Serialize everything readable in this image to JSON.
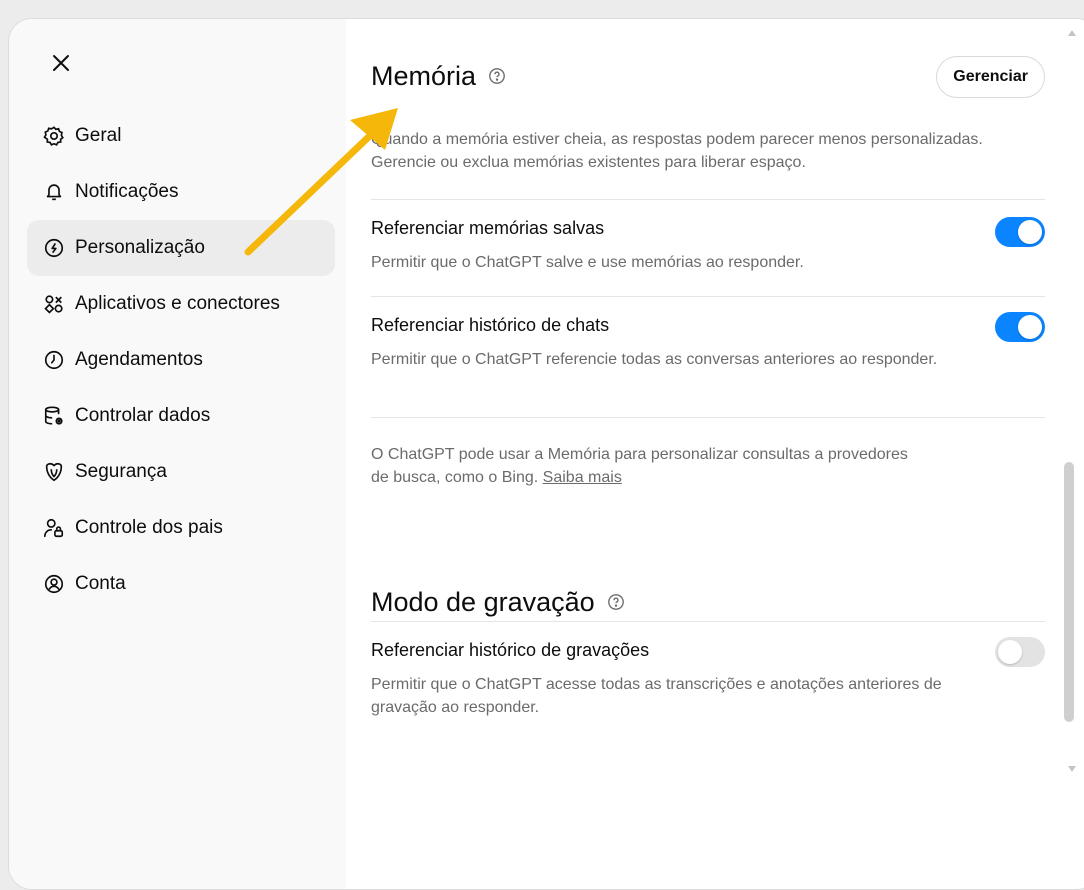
{
  "sidebar": {
    "items": [
      {
        "label": "Geral",
        "icon": "gear-icon"
      },
      {
        "label": "Notificações",
        "icon": "bell-icon"
      },
      {
        "label": "Personalização",
        "icon": "personalization-icon",
        "active": true
      },
      {
        "label": "Aplicativos e conectores",
        "icon": "apps-icon"
      },
      {
        "label": "Agendamentos",
        "icon": "clock-icon"
      },
      {
        "label": "Controlar dados",
        "icon": "database-gear-icon"
      },
      {
        "label": "Segurança",
        "icon": "security-icon"
      },
      {
        "label": "Controle dos pais",
        "icon": "parental-icon"
      },
      {
        "label": "Conta",
        "icon": "account-icon"
      }
    ]
  },
  "memory": {
    "title": "Memória",
    "manage_label": "Gerenciar",
    "description": "Quando a memória estiver cheia, as respostas podem parecer menos personalizadas. Gerencie ou exclua memórias existentes para liberar espaço.",
    "saved": {
      "title": "Referenciar memórias salvas",
      "description": "Permitir que o ChatGPT salve e use memórias ao responder.",
      "enabled": true
    },
    "history": {
      "title": "Referenciar histórico de chats",
      "description": "Permitir que o ChatGPT referencie todas as conversas anteriores ao responder.",
      "enabled": true
    },
    "search_note": "O ChatGPT pode usar a Memória para personalizar consultas a provedores de busca, como o Bing.",
    "learn_more": "Saiba mais"
  },
  "recording": {
    "title": "Modo de gravação",
    "history": {
      "title": "Referenciar histórico de gravações",
      "description": "Permitir que o ChatGPT acesse todas as transcrições e anotações anteriores de gravação ao responder.",
      "enabled": false
    }
  },
  "colors": {
    "toggle_on": "#0a84ff",
    "annotation_arrow": "#f5b80a"
  }
}
